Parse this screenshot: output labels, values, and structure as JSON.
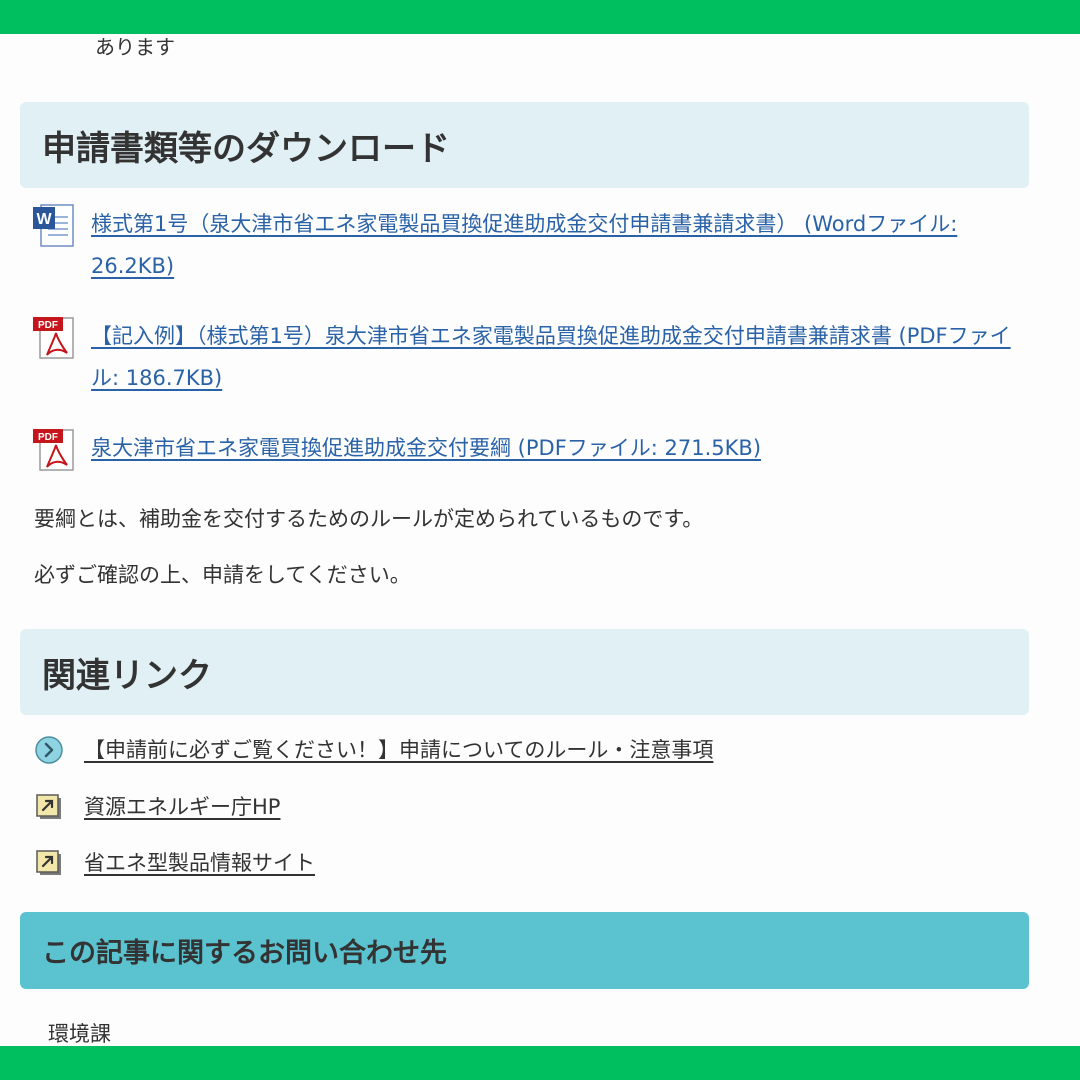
{
  "top_text": "あります",
  "downloads": {
    "heading": "申請書類等のダウンロード",
    "files": [
      {
        "icon": "word-file-icon",
        "label": "様式第1号（泉大津市省エネ家電製品買換促進助成金交付申請書兼請求書） (Wordファイル: 26.2KB)"
      },
      {
        "icon": "pdf-file-icon",
        "label": "【記入例】（様式第1号）泉大津市省エネ家電製品買換促進助成金交付申請書兼請求書 (PDFファイル: 186.7KB)"
      },
      {
        "icon": "pdf-file-icon",
        "label": "泉大津市省エネ家電買換促進助成金交付要綱 (PDFファイル: 271.5KB)"
      }
    ],
    "note1": "要綱とは、補助金を交付するためのルールが定められているものです。",
    "note2": "必ずご確認の上、申請をしてください。"
  },
  "related": {
    "heading": "関連リンク",
    "links": [
      {
        "icon": "chevron-circle-icon",
        "label": "【申請前に必ずご覧ください！】申請についてのルール・注意事項"
      },
      {
        "icon": "external-link-icon",
        "label": "資源エネルギー庁HP"
      },
      {
        "icon": "external-link-icon",
        "label": "省エネ型製品情報サイト"
      }
    ]
  },
  "contact": {
    "heading": "この記事に関するお問い合わせ先",
    "department": "環境課"
  },
  "icon_labels": {
    "word": "W",
    "pdf": "PDF"
  },
  "colors": {
    "frame_green": "#00bf5f",
    "heading_light": "#e0f0f4",
    "heading_dark": "#5bc2d0",
    "link_blue": "#2a62a8",
    "text": "#333333"
  }
}
